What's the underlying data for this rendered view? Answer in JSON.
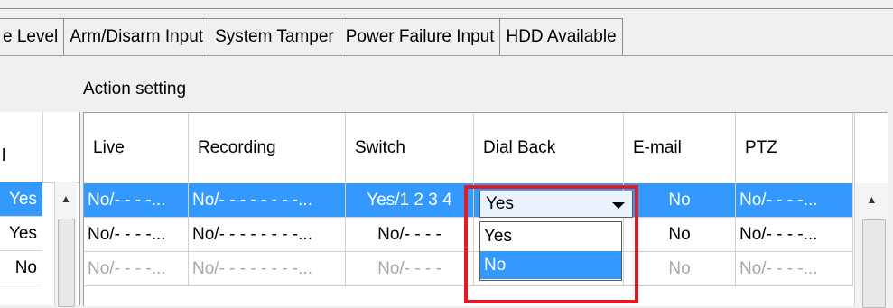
{
  "tabs": [
    {
      "label": "e Level"
    },
    {
      "label": "Arm/Disarm Input"
    },
    {
      "label": "System Tamper"
    },
    {
      "label": "Power Failure Input"
    },
    {
      "label": "HDD Available"
    }
  ],
  "section_title": "Action setting",
  "left_table": {
    "header_fragment": "l",
    "rows": [
      "Yes",
      "Yes",
      "No"
    ]
  },
  "columns": [
    "Live",
    "Recording",
    "Switch",
    "Dial Back",
    "E-mail",
    "PTZ"
  ],
  "rows": [
    {
      "live": "No/- - - -...",
      "recording": "No/- - - - - - - -...",
      "switch": "Yes/1 2 3 4",
      "dial_back": "Yes",
      "email": "No",
      "ptz": "No/- - - -..."
    },
    {
      "live": "No/- - - -...",
      "recording": "No/- - - - - - - -...",
      "switch": "No/- - - -",
      "dial_back": "Yes",
      "email": "No",
      "ptz": "No/- - - -..."
    },
    {
      "live": "No/- - - -...",
      "recording": "No/- - - - - - - -...",
      "switch": "No/- - - -",
      "dial_back": "No",
      "email": "No",
      "ptz": "No/- - - -..."
    }
  ],
  "combo": {
    "value": "Yes",
    "options": [
      "Yes",
      "No"
    ],
    "highlighted": "No"
  },
  "scroll_up_glyph": "▲",
  "colors": {
    "selection": "#3399ff",
    "highlight_box": "#e01b24"
  }
}
